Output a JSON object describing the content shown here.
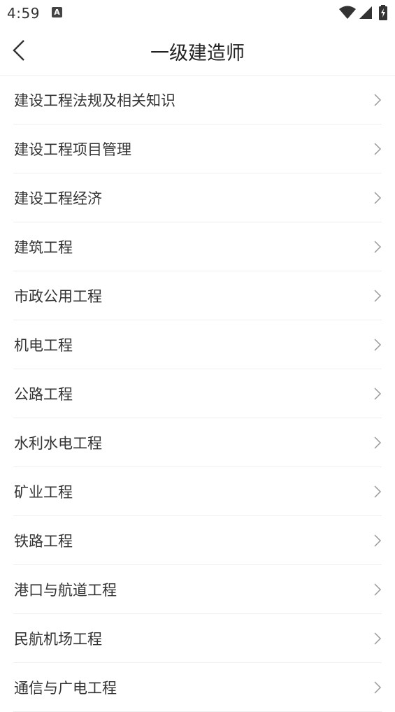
{
  "status_bar": {
    "time": "4:59",
    "notification_icon_letter": "A"
  },
  "header": {
    "title": "一级建造师"
  },
  "list": {
    "items": [
      {
        "label": "建设工程法规及相关知识"
      },
      {
        "label": "建设工程项目管理"
      },
      {
        "label": "建设工程经济"
      },
      {
        "label": "建筑工程"
      },
      {
        "label": "市政公用工程"
      },
      {
        "label": "机电工程"
      },
      {
        "label": "公路工程"
      },
      {
        "label": "水利水电工程"
      },
      {
        "label": "矿业工程"
      },
      {
        "label": "铁路工程"
      },
      {
        "label": "港口与航道工程"
      },
      {
        "label": "民航机场工程"
      },
      {
        "label": "通信与广电工程"
      }
    ]
  },
  "icons": {
    "back": "chevron-left-icon",
    "row": "chevron-right-icon",
    "status": [
      "wifi-icon",
      "cellular-signal-icon",
      "battery-charging-icon"
    ]
  },
  "colors": {
    "text": "#333333",
    "divider": "#eeeeee",
    "chevron": "#999999",
    "background": "#ffffff"
  }
}
